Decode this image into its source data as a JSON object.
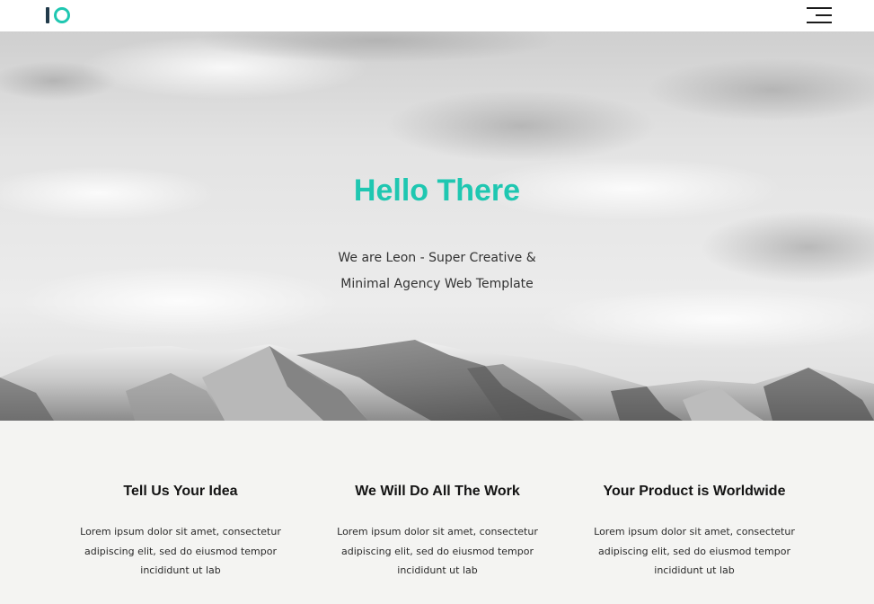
{
  "navbar": {
    "logo_alt": "IO",
    "menu_icon": "hamburger-menu-icon"
  },
  "hero": {
    "title": "Hello There",
    "subtitle_line1": "We are Leon - Super Creative &",
    "subtitle_line2": "Minimal Agency Web Template"
  },
  "features": [
    {
      "title": "Tell Us Your Idea",
      "text": "Lorem ipsum dolor sit amet, consectetur adipiscing elit, sed do eiusmod tempor incididunt ut lab"
    },
    {
      "title": "We Will Do All The Work",
      "text": "Lorem ipsum dolor sit amet, consectetur adipiscing elit, sed do eiusmod tempor incididunt ut lab"
    },
    {
      "title": "Your Product is Worldwide",
      "text": "Lorem ipsum dolor sit amet, consectetur adipiscing elit, sed do eiusmod tempor incididunt ut lab"
    }
  ],
  "colors": {
    "accent": "#1fc7b1",
    "logo_dark": "#213a4a",
    "section_bg": "#f4f4f2"
  }
}
